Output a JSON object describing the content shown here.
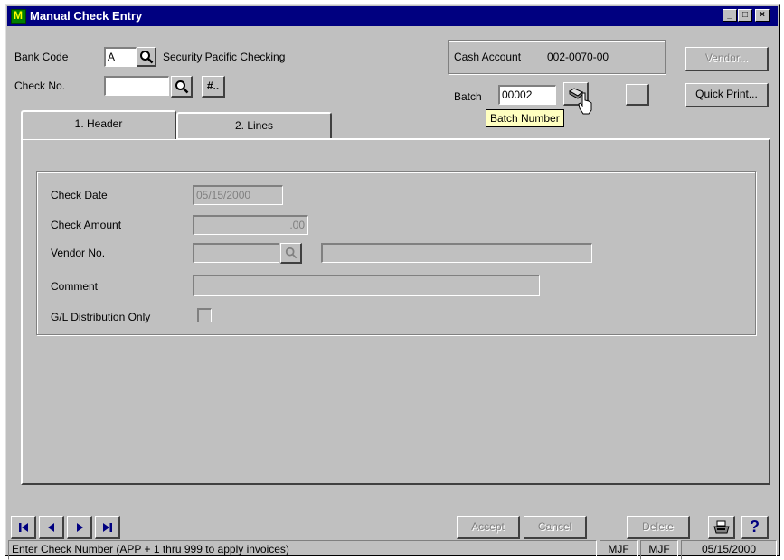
{
  "window": {
    "title": "Manual Check Entry",
    "minimize": "_",
    "maximize": "□",
    "close": "×"
  },
  "top": {
    "bank_code_label": "Bank Code",
    "bank_code_value": "A",
    "bank_name": "Security Pacific Checking",
    "check_no_label": "Check No.",
    "check_no_value": "",
    "next_number_button": "#..",
    "cash_account_label": "Cash Account",
    "cash_account_value": "002-0070-00",
    "batch_label": "Batch",
    "batch_value": "00002",
    "vendor_button": "Vendor...",
    "quick_print_button": "Quick Print...",
    "tooltip": "Batch Number"
  },
  "tabs": [
    {
      "label": "1. Header"
    },
    {
      "label": "2. Lines"
    }
  ],
  "header_form": {
    "check_date_label": "Check Date",
    "check_date_value": "05/15/2000",
    "check_amount_label": "Check Amount",
    "check_amount_value": ".00",
    "vendor_no_label": "Vendor No.",
    "vendor_no_value": "",
    "vendor_name_value": "",
    "comment_label": "Comment",
    "comment_value": "",
    "gl_only_label": "G/L Distribution Only",
    "gl_only_checked": false
  },
  "footer": {
    "accept": "Accept",
    "cancel": "Cancel",
    "delete": "Delete",
    "help": "?",
    "nav": [
      "first",
      "previous",
      "next",
      "last"
    ]
  },
  "statusbar": {
    "message": "Enter Check Number (APP + 1 thru 999 to apply invoices)",
    "user1": "MJF",
    "user2": "MJF",
    "date": "05/15/2000"
  }
}
